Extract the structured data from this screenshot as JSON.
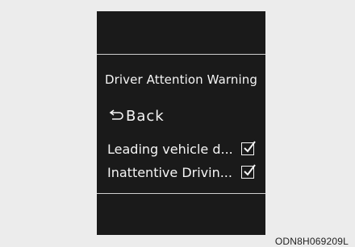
{
  "screen": {
    "title": "Driver Attention Warning",
    "back": {
      "label": "Back",
      "icon": "back-arrow-icon"
    },
    "items": [
      {
        "label": "Leading vehicle d...",
        "checked": true,
        "icon": "checkmark-icon"
      },
      {
        "label": "Inattentive Drivin...",
        "checked": true,
        "icon": "checkmark-icon"
      }
    ]
  },
  "figure_code": "ODN8H069209L",
  "colors": {
    "screen_bg": "#1a1a1a",
    "page_bg": "#ececec",
    "text": "#f5f5f5"
  }
}
